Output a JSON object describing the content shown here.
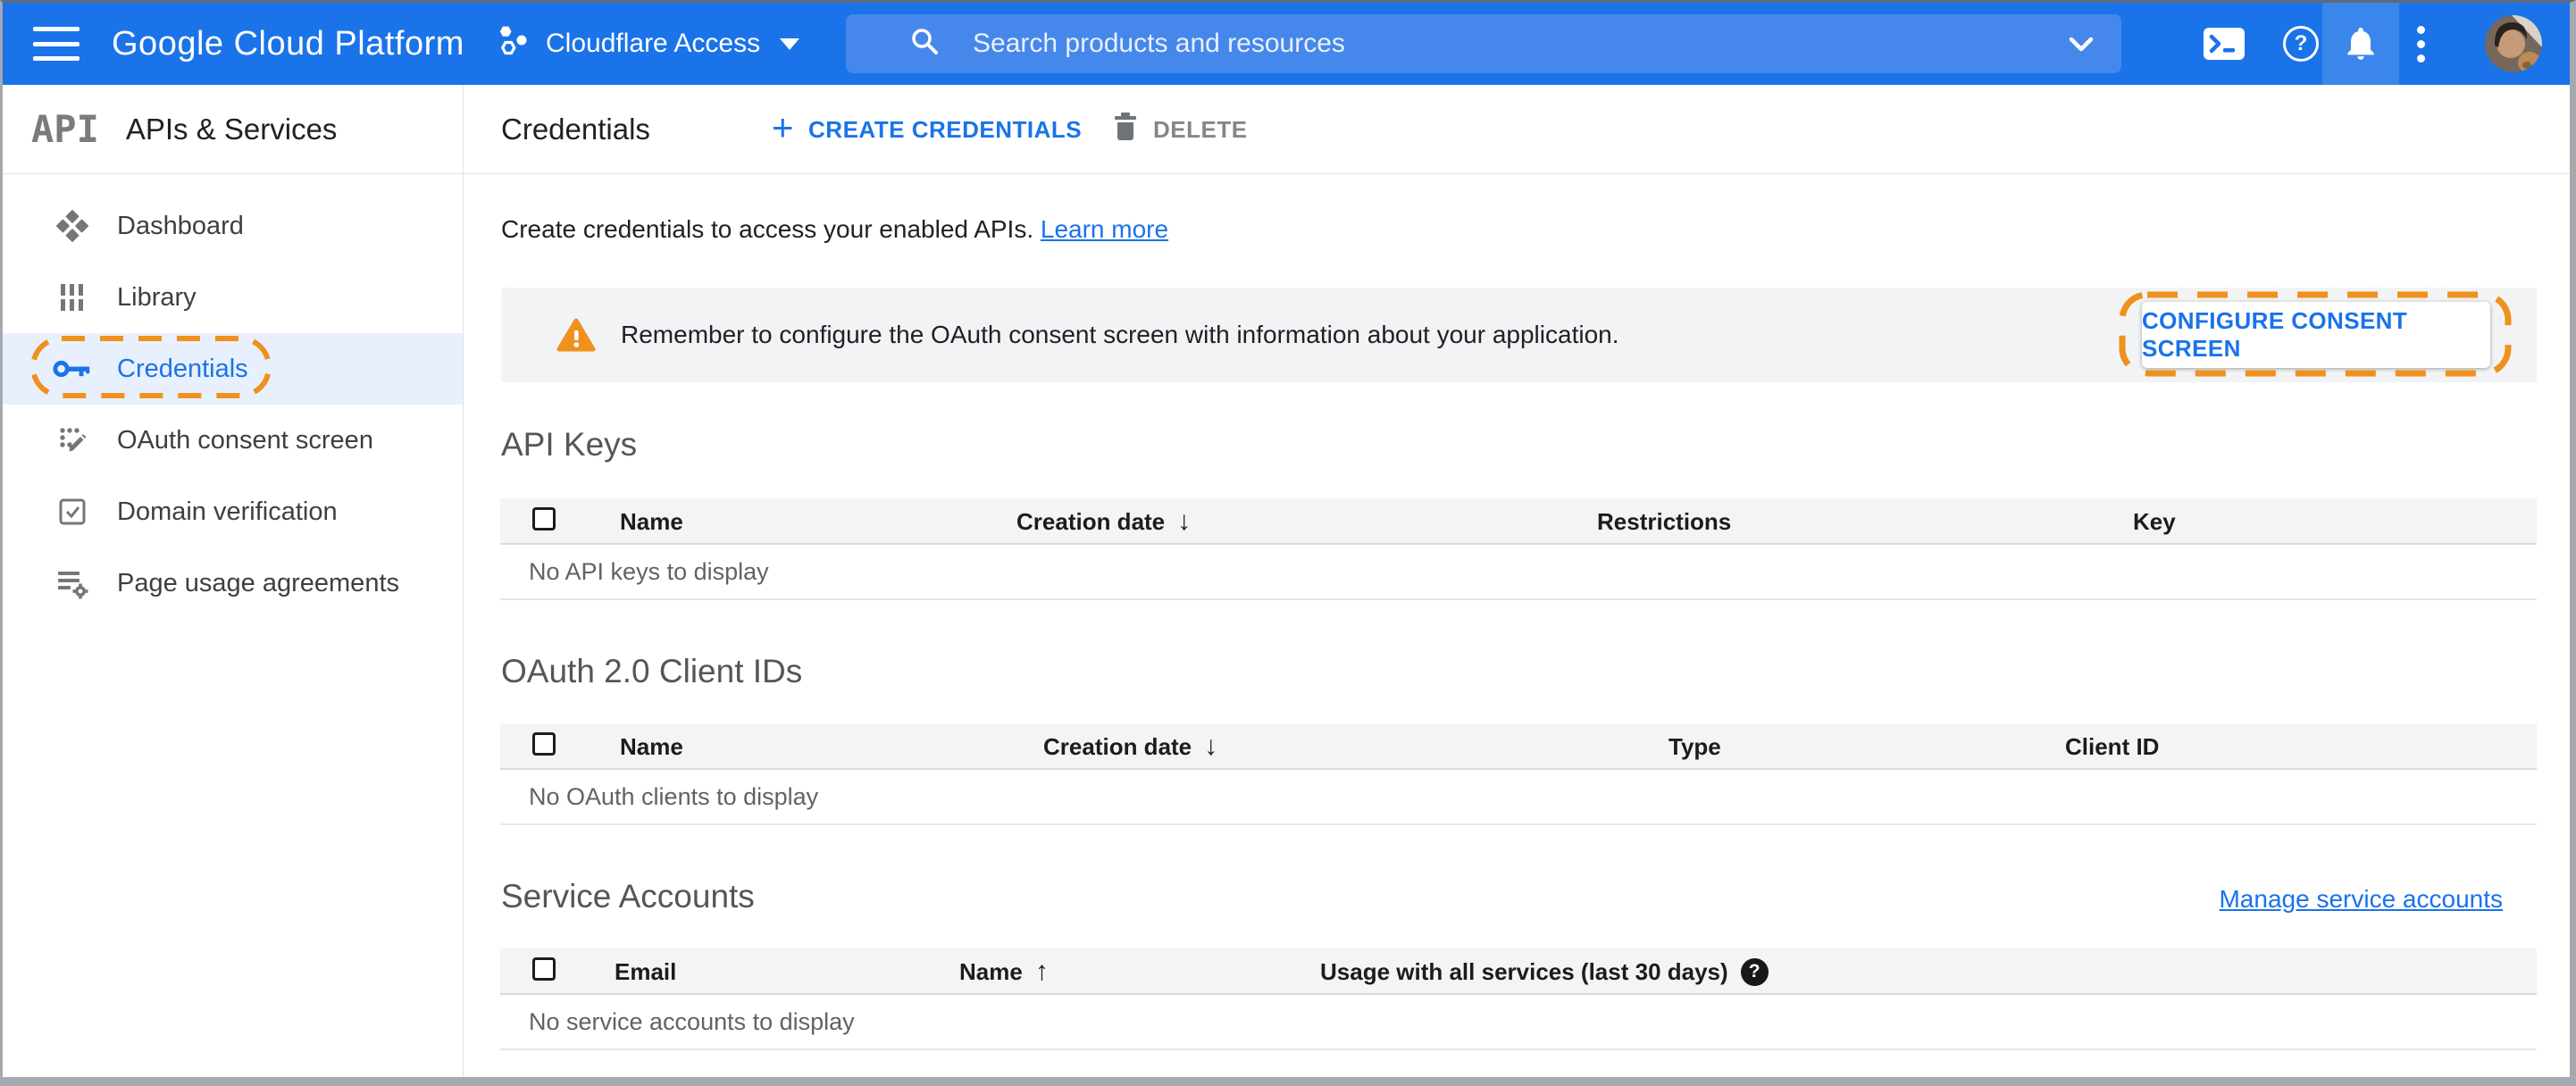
{
  "header": {
    "logo": "Google Cloud Platform",
    "project_name": "Cloudflare Access",
    "search_placeholder": "Search products and resources"
  },
  "sidebar": {
    "product_logo": "API",
    "title": "APIs & Services",
    "items": [
      {
        "label": "Dashboard"
      },
      {
        "label": "Library"
      },
      {
        "label": "Credentials",
        "active": true
      },
      {
        "label": "OAuth consent screen"
      },
      {
        "label": "Domain verification"
      },
      {
        "label": "Page usage agreements"
      }
    ]
  },
  "toolbar": {
    "title": "Credentials",
    "create_label": "CREATE CREDENTIALS",
    "delete_label": "DELETE"
  },
  "intro": {
    "text": "Create credentials to access your enabled APIs.",
    "link": "Learn more"
  },
  "banner": {
    "message": "Remember to configure the OAuth consent screen with information about your application.",
    "button": "CONFIGURE CONSENT SCREEN"
  },
  "sections": {
    "api_keys": {
      "title": "API Keys",
      "columns": [
        "Name",
        "Creation date",
        "Restrictions",
        "Key"
      ],
      "sort_column": "Creation date",
      "sort_direction": "desc",
      "empty": "No API keys to display"
    },
    "oauth_clients": {
      "title": "OAuth 2.0 Client IDs",
      "columns": [
        "Name",
        "Creation date",
        "Type",
        "Client ID"
      ],
      "sort_column": "Creation date",
      "sort_direction": "desc",
      "empty": "No OAuth clients to display"
    },
    "service_accounts": {
      "title": "Service Accounts",
      "manage_link": "Manage service accounts",
      "columns": [
        "Email",
        "Name",
        "Usage with all services (last 30 days)"
      ],
      "sort_column": "Name",
      "sort_direction": "asc",
      "empty": "No service accounts to display"
    }
  },
  "icons": {
    "sort_desc": "↓",
    "sort_asc": "↑",
    "help": "?",
    "help_filled": "?",
    "plus": "+"
  },
  "colors": {
    "header_blue": "#1a73e8",
    "accent_blue": "#1a73e8",
    "annotation_orange": "#f0911e",
    "banner_bg": "#f1f3f4",
    "selected_nav_bg": "#e8f0fe"
  }
}
